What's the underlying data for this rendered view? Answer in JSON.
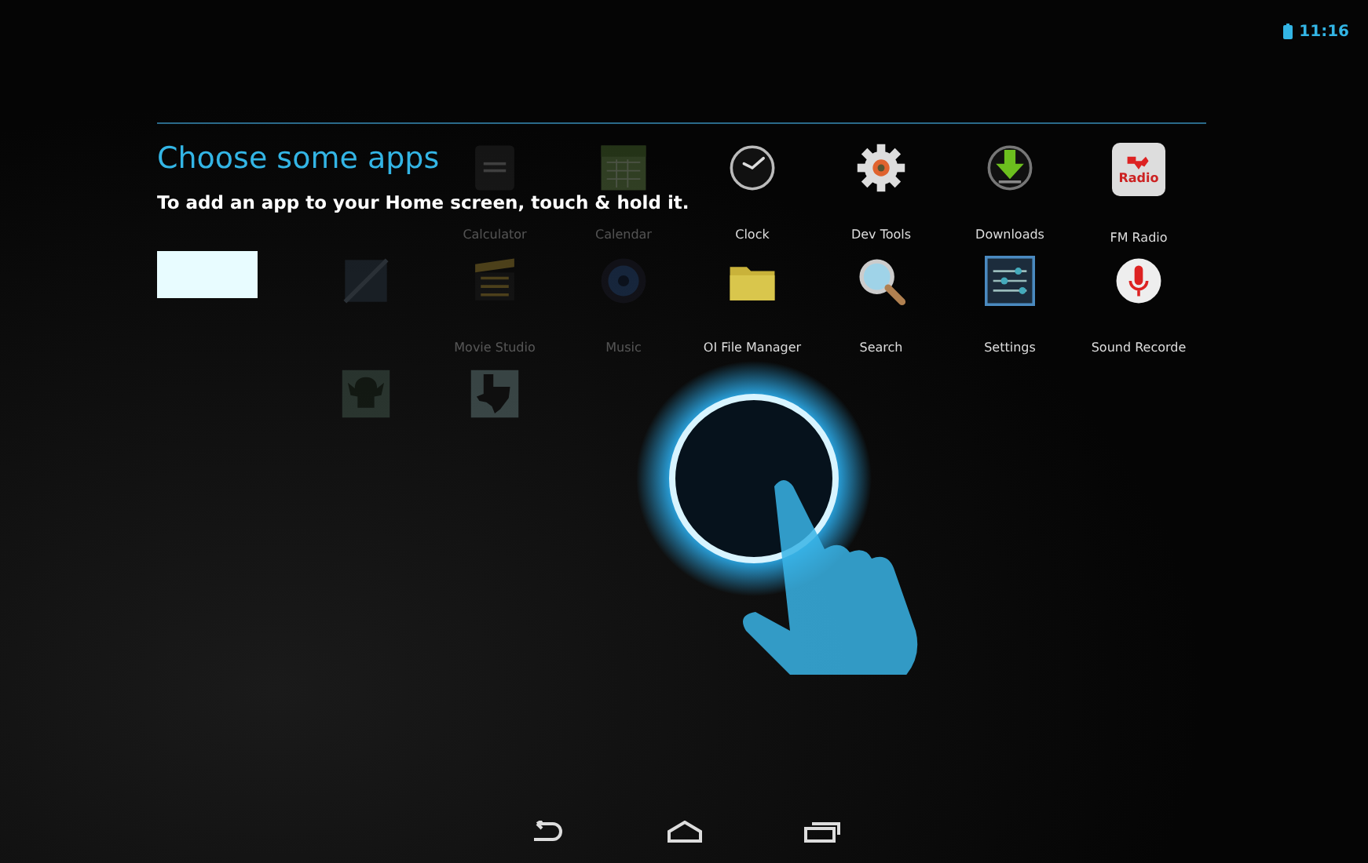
{
  "status_bar": {
    "time": "11:16"
  },
  "tutorial": {
    "title": "Choose some apps",
    "text": "To add an app to your Home screen, touch & hold it."
  },
  "app_rows": [
    [
      {
        "label": "Calculator",
        "dimmed": true
      },
      {
        "label": "Calendar",
        "dimmed": true
      },
      {
        "label": "Clock",
        "dimmed": false
      },
      {
        "label": "Dev Tools",
        "dimmed": false
      },
      {
        "label": "Downloads",
        "dimmed": false
      },
      {
        "label": "FM Radio",
        "dimmed": false,
        "icon_text": "Radio"
      }
    ],
    [
      {
        "dimmed": true
      },
      {
        "label": "Movie Studio",
        "dimmed": true
      },
      {
        "label": "Music",
        "dimmed": true
      },
      {
        "label": "OI File Manager",
        "dimmed": false
      },
      {
        "label": "Search",
        "dimmed": false
      },
      {
        "label": "Settings",
        "dimmed": false
      },
      {
        "label": "Sound Recorde",
        "dimmed": false
      }
    ],
    [
      {
        "dimmed": true
      },
      {
        "dimmed": true
      }
    ]
  ]
}
